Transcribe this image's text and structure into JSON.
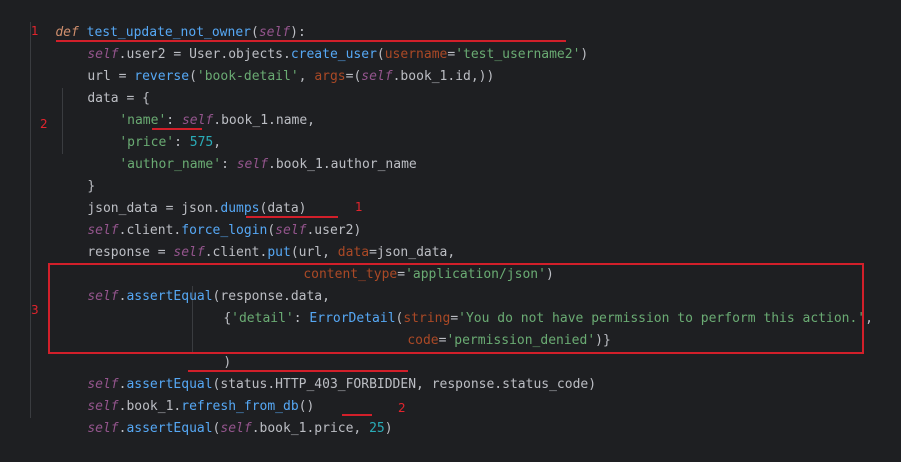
{
  "code": {
    "line1": [
      "def",
      " ",
      "test_update_not_owner",
      "(",
      "self",
      "):"
    ],
    "line2": [
      "self",
      ".user2 = User.objects.",
      "create_user",
      "(",
      "username",
      "=",
      "'test_username2'",
      ")"
    ],
    "line3": [
      "url = ",
      "reverse",
      "(",
      "'book-detail'",
      ", ",
      "args",
      "=(",
      "self",
      ".book_1.id,))"
    ],
    "line4": [
      "data = {"
    ],
    "line5": [
      "'name'",
      ": ",
      "self",
      ".book_1.name,"
    ],
    "line6": [
      "'price'",
      ": ",
      "575",
      ","
    ],
    "line7": [
      "'author_name'",
      ": ",
      "self",
      ".book_1.author_name"
    ],
    "line8": [
      "}"
    ],
    "line9": [
      "json_data = json.",
      "dumps",
      "(data)"
    ],
    "line10": [
      "self",
      ".client.",
      "force_login",
      "(",
      "self",
      ".user2)"
    ],
    "line11": [
      "response = ",
      "self",
      ".client.",
      "put",
      "(url, ",
      "data",
      "=json_data,"
    ],
    "line12": [
      "content_type",
      "=",
      "'application/json'",
      ")"
    ],
    "line13": [
      "self",
      ".",
      "assertEqual",
      "(response.data,"
    ],
    "line14": [
      "{",
      "'detail'",
      ": ",
      "ErrorDetail",
      "(",
      "string",
      "=",
      "'You do not have permission to perform this action.'",
      ","
    ],
    "line15": [
      "code",
      "=",
      "'permission_denied'",
      ")}"
    ],
    "line16": [
      ")"
    ],
    "line17": [
      "self",
      ".",
      "assertEqual",
      "(status.HTTP_403_FORBIDDEN, response.status_code)"
    ],
    "line18": [
      "self",
      ".book_1.",
      "refresh_from_db",
      "()"
    ],
    "line19": [
      "self",
      ".",
      "assertEqual",
      "(",
      "self",
      ".book_1.price, ",
      "25",
      ")"
    ]
  },
  "annotations": {
    "mark1a": "1",
    "mark1b": "1",
    "mark2a": "2",
    "mark2b": "2",
    "mark3": "3"
  },
  "colors": {
    "background": "#1e1f22",
    "keyword": "#cf8e6d",
    "self": "#94558d",
    "function": "#56a8f5",
    "string": "#6aab73",
    "number": "#2aacb8",
    "param": "#aa4926",
    "annotation_red": "#d21f2a"
  }
}
